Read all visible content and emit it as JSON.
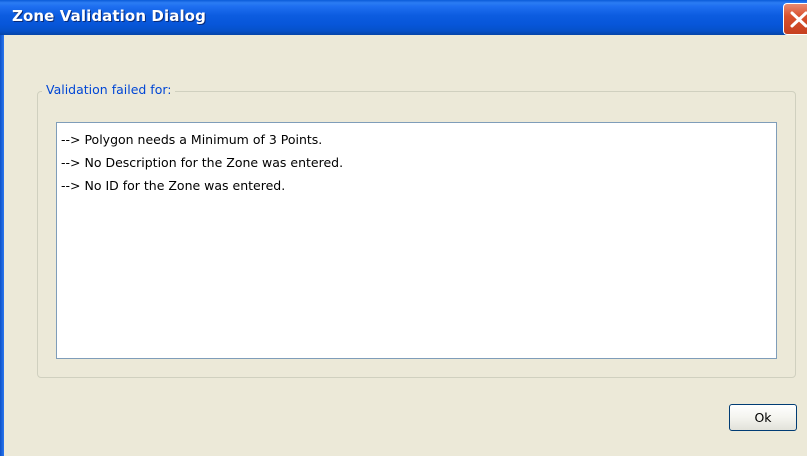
{
  "dialog": {
    "title": "Zone Validation Dialog"
  },
  "group": {
    "legend": "Validation failed for:"
  },
  "messages": [
    "--> Polygon needs a Minimum of 3 Points.",
    "--> No Description for the Zone was entered.",
    "--> No ID for the Zone was entered."
  ],
  "buttons": {
    "ok_label": "Ok"
  },
  "icons": {
    "close": "close-icon"
  },
  "colors": {
    "titlebar_blue": "#0c5ce0",
    "dialog_bg": "#ece9d8",
    "legend_text": "#0046d5",
    "close_button": "#d9522e"
  }
}
